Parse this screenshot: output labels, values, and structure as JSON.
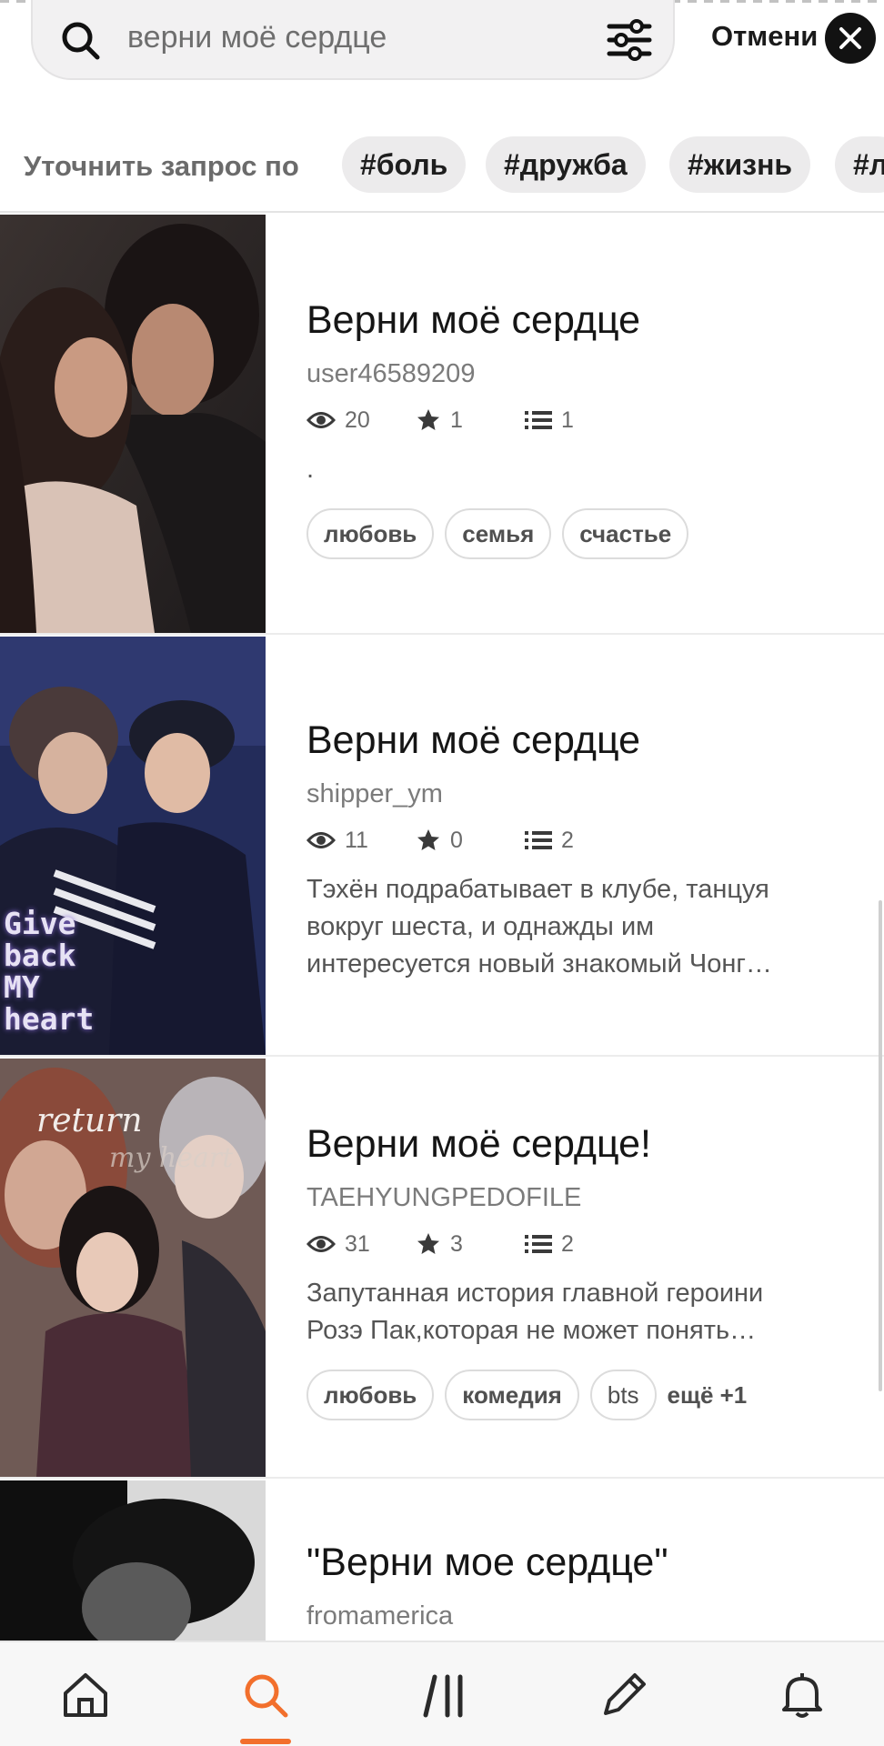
{
  "search": {
    "query": "верни моё сердце",
    "cancel_label": "Отмени"
  },
  "refine": {
    "label": "Уточнить запрос по",
    "tags": [
      "#боль",
      "#дружба",
      "#жизнь",
      "#л"
    ]
  },
  "stories": [
    {
      "title": "Верни моё сердце",
      "author": "user46589209",
      "reads": "20",
      "votes": "1",
      "parts": "1",
      "description": ".",
      "tags": [
        "любовь",
        "семья",
        "счастье"
      ]
    },
    {
      "title": "Верни моё сердце",
      "author": "shipper_ym",
      "reads": "11",
      "votes": "0",
      "parts": "2",
      "description_lines": [
        "Тэхён подрабатывает в клубе, танцуя",
        "вокруг шеста, и однажды им",
        "интересуется новый знакомый Чонг…"
      ],
      "cover_text": [
        "Give",
        "back",
        "MY",
        "heart"
      ]
    },
    {
      "title": "Верни моё сердце!",
      "author": "TAEHYUNGPEDOFILE",
      "reads": "31",
      "votes": "3",
      "parts": "2",
      "description_lines": [
        "Запутанная история главной героини",
        "Розэ Пак,которая не может понять…"
      ],
      "tags": [
        "любовь",
        "комедия",
        "bts"
      ],
      "more_tags": "ещё +1",
      "cover_text": [
        "return",
        "my heart"
      ]
    },
    {
      "title": "\"Верни мое сердце\"",
      "author": "fromamerica"
    }
  ],
  "nav": {
    "items": [
      "home-icon",
      "search-icon",
      "library-icon",
      "pencil-icon",
      "bell-icon"
    ],
    "active": "search-icon"
  },
  "colors": {
    "accent": "#f26f2c",
    "text": "#151515",
    "muted": "#7b7b7b"
  }
}
